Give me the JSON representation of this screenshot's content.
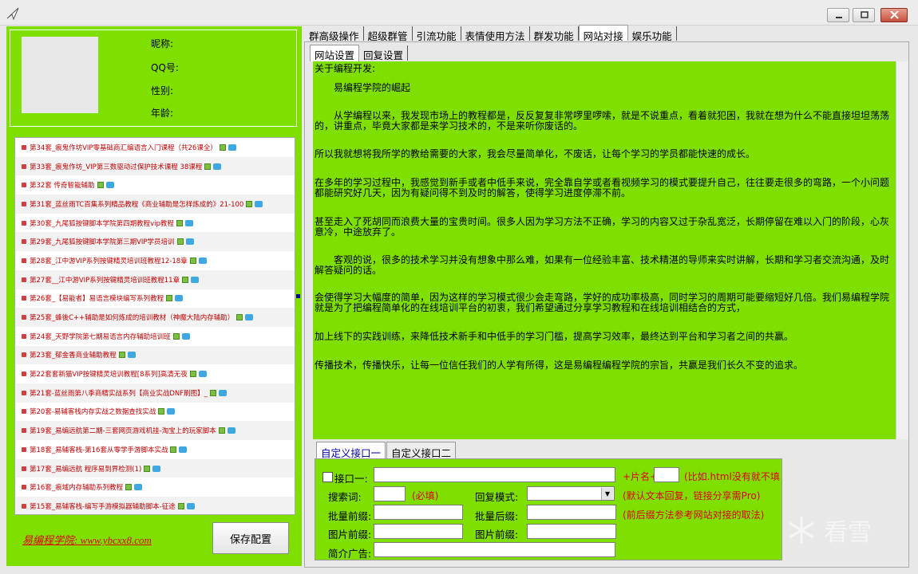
{
  "window": {
    "minimize": "min",
    "maximize": "max",
    "close": "close"
  },
  "profile": {
    "nickname_label": "昵称:",
    "qq_label": "QQ号:",
    "gender_label": "性别:",
    "age_label": "年龄:"
  },
  "courses": [
    "第34套_痕鬼作坊VIP零基础商汇编语言入门课程（共26课全）",
    "第33套_痕鬼作坊_VIP第三数驱动过保护技术课程 38课程",
    "第32套 传奇智能辅助",
    "第31套_蓝丝雨TC百集系列精品教程《商业辅助是怎样炼成的》21-100",
    "第30套_九尾狐按键脚本学院第四期教程vip教程",
    "第29套_九尾狐按键脚本学院第三期VIP学员培训",
    "第28套_江中游VIP系列按键精灵培训班教程12-18章",
    "第27套__江中游VIP系列按键精灵培训班教程11章",
    "第26套_【易能者】易语言模块编写系列教程",
    "第25套_蜂後C++辅助是如何炼成的培训教材（神魔大陆内存辅助）",
    "第24套_天野学院第七期易语言内存辅助培训班",
    "第23套_郁金香商业辅助教程",
    "第22套套新猫VIP按键精灵培训教程[8系列]高清无夜",
    "第21套-蓝丝雨第八季商精实战系列【商业实战DNF刷图】_",
    "第20套-易辅客栈内存实战之数据查找实战",
    "第19套_易编远航第二期-三套网页游戏机挂-淘宝上的玩家脚本",
    "第18套_易辅客栈-第16套从零学手游脚本实战",
    "第17套_易编远航 程序易到界检测(1)",
    "第16套_痕域内存辅助系列教程",
    "第15套_易辅客栈-编写手游模拟器辅助脚本-征途"
  ],
  "footer_link": "易编程学院: www.ybcxx8.com",
  "save_button": "保存配置",
  "tabs": [
    "群高级操作",
    "超级群管",
    "引流功能",
    "表情使用方法",
    "群发功能",
    "网站对接",
    "娱乐功能"
  ],
  "active_tab": "网站对接",
  "subtabs": [
    "网站设置",
    "回复设置"
  ],
  "about": {
    "heading": "关于编程开发:",
    "title": "易编程学院的崛起",
    "paragraphs": [
      "　　从学编程以来，我发现市场上的教程都是，反反复复非常啰里啰嗦，就是不说重点，看着就犯困，我就在想为什么不能直接坦坦荡荡的，讲重点，毕竟大家都是来学习技术的，不是来听你废话的。",
      "所以我就想将我所学的教给需要的大家，我会尽量简单化，不废话，让每个学习的学员都能快速的成长。",
      "在多年的学习过程中，我感觉到新手或者中低手来说，完全靠自学或者看视频学习的模式要提升自己，往往要走很多的弯路，一个小问题都能研究好几天，因为有疑问得不到及时的解答，使得学习进度停滞不前。",
      "甚至走入了死胡同而浪费大量的宝贵时间。很多人因为学习方法不正确，学习的内容又过于杂乱宽泛，长期停留在难以入门的阶段，心灰意冷，中途放弃了。",
      "　　客观的说，很多的技术学习并没有想象中那么难，如果有一位经验丰富、技术精湛的导师来实时讲解，长期和学习者交流沟通，及时解答疑问的话。",
      "会使得学习大幅度的简单，因为这样的学习模式很少会走弯路，学好的成功率极高，同时学习的周期可能要缩短好几倍。我们易编程学院就是为了把编程简单化的在线培训平台的初衷，我们希望通过分享学习教程和在线培训相结合的方式，",
      "加上线下的实践训练，来降低技术新手和中低手的学习门槛，提高学习效率，最终达到平台和学习者之间的共赢。",
      "传播技术，传播快乐，让每一位信任我们的人学有所得，这是易编程编程学院的宗旨，共赢是我们长久不变的追求。"
    ]
  },
  "custom_tabs": [
    "自定义接口一",
    "自定义接口二"
  ],
  "config": {
    "interface_label": "接口一:",
    "suffix_label": "+片名+",
    "suffix_note": "(比如.html没有就不填",
    "search_label": "搜索词:",
    "required_note": "(必填)",
    "reply_mode_label": "回复模式:",
    "default_note": "(默认文本回复，链接分享需Pro)",
    "batch_prefix_label": "批量前缀:",
    "batch_suffix_label": "批量后缀:",
    "prefix_note": "(前后缀方法参考网站对接的取法)",
    "img_prefix_label": "图片前缀:",
    "img_prefix2_label": "图片前缀:",
    "ad_label": "简介广告:"
  },
  "watermark": "看雪",
  "colors": {
    "panel_green": "#7fe000",
    "red_text": "#e00000"
  }
}
